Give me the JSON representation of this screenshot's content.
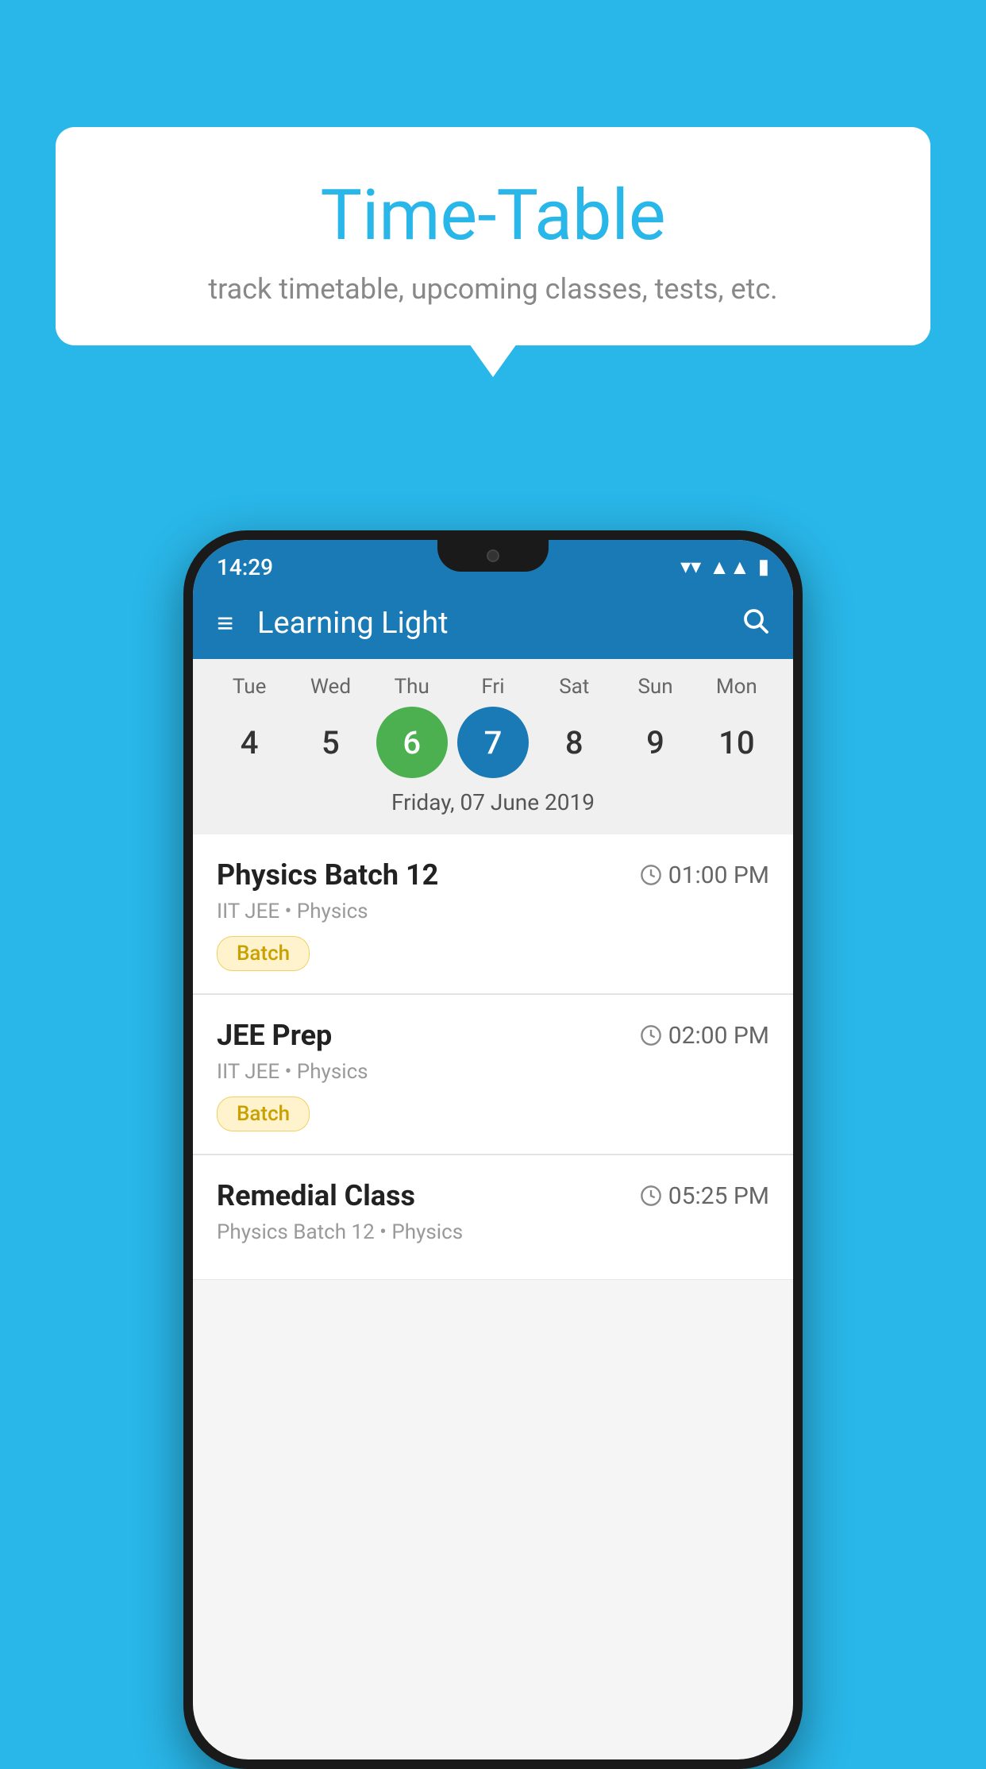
{
  "page": {
    "background_color": "#29b6e8"
  },
  "bubble": {
    "title": "Time-Table",
    "subtitle": "track timetable, upcoming classes, tests, etc."
  },
  "phone": {
    "status_bar": {
      "time": "14:29"
    },
    "app_bar": {
      "title": "Learning Light",
      "menu_icon": "☰",
      "search_icon": "🔍"
    },
    "calendar": {
      "days": [
        {
          "label": "Tue",
          "number": "4"
        },
        {
          "label": "Wed",
          "number": "5"
        },
        {
          "label": "Thu",
          "number": "6",
          "state": "today"
        },
        {
          "label": "Fri",
          "number": "7",
          "state": "selected"
        },
        {
          "label": "Sat",
          "number": "8"
        },
        {
          "label": "Sun",
          "number": "9"
        },
        {
          "label": "Mon",
          "number": "10"
        }
      ],
      "selected_date": "Friday, 07 June 2019"
    },
    "schedule": [
      {
        "title": "Physics Batch 12",
        "time": "01:00 PM",
        "subtitle": "IIT JEE • Physics",
        "tag": "Batch"
      },
      {
        "title": "JEE Prep",
        "time": "02:00 PM",
        "subtitle": "IIT JEE • Physics",
        "tag": "Batch"
      },
      {
        "title": "Remedial Class",
        "time": "05:25 PM",
        "subtitle": "Physics Batch 12 • Physics",
        "tag": null
      }
    ]
  }
}
